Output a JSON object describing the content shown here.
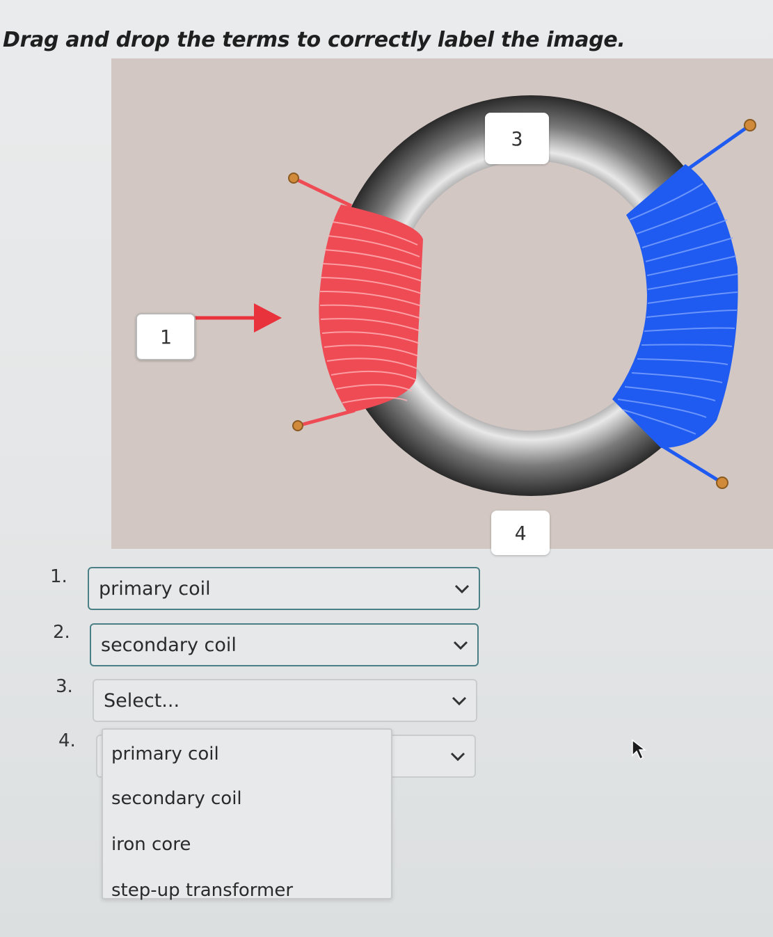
{
  "instruction": "Drag and drop the terms to correctly label the image.",
  "diagram": {
    "labels": {
      "one": "1",
      "three": "3",
      "four": "4"
    },
    "colors": {
      "primary_coil": "#ef4b55",
      "secondary_coil": "#1f5bf0",
      "core": "#5a5a5a",
      "arrow": "#e8323c"
    }
  },
  "questions": [
    {
      "number": "1.",
      "value": "primary coil"
    },
    {
      "number": "2.",
      "value": "secondary coil"
    },
    {
      "number": "3.",
      "value": "Select..."
    },
    {
      "number": "4.",
      "value": ""
    }
  ],
  "dropdown_options": [
    "primary coil",
    "secondary coil",
    "iron core",
    "step-up transformer"
  ],
  "icons": {
    "chevron": "chevron-down-icon",
    "cursor": "mouse-pointer-icon"
  }
}
